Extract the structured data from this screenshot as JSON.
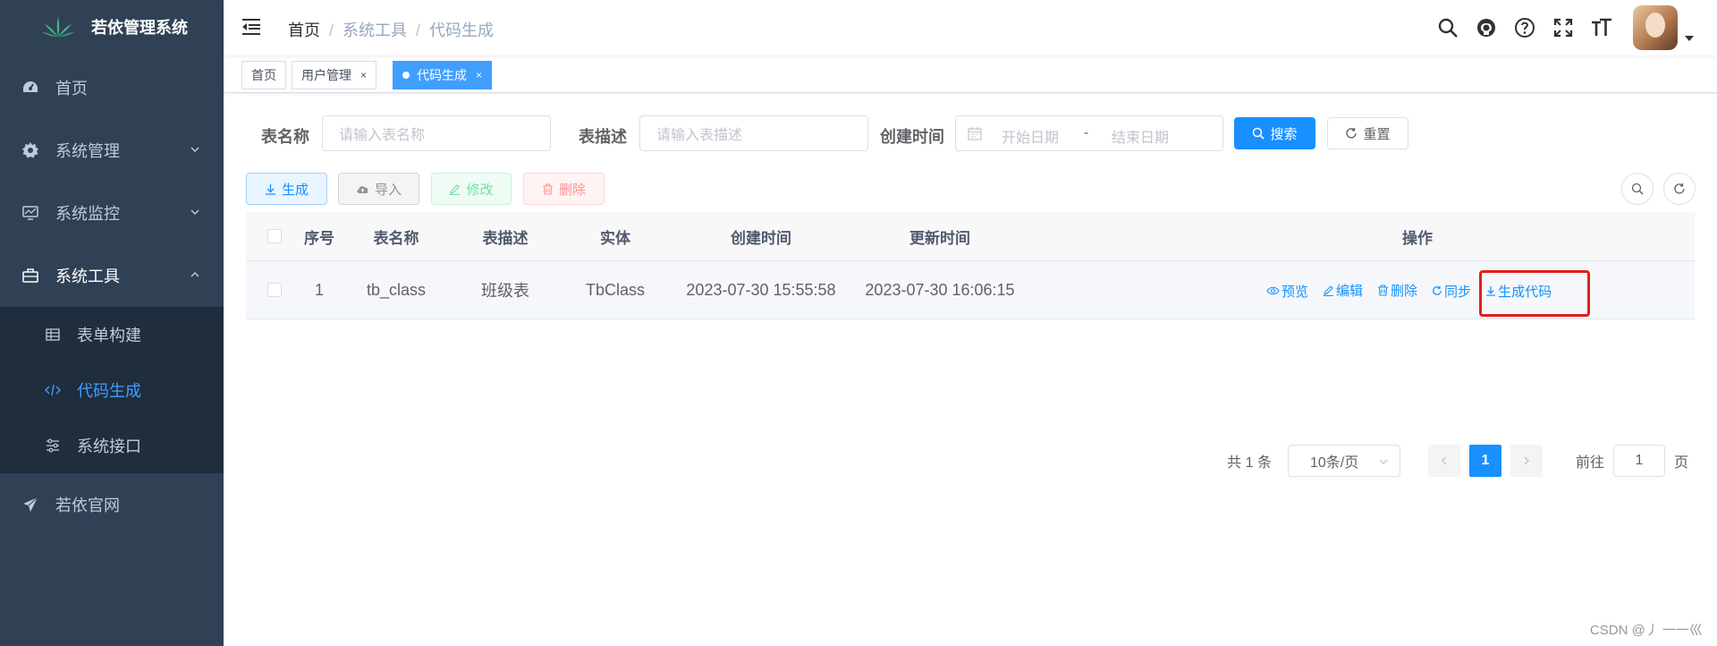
{
  "sidebar": {
    "logo_title": "若依管理系统",
    "items": [
      {
        "label": "首页",
        "icon": "dashboard-icon"
      },
      {
        "label": "系统管理",
        "icon": "gear-icon"
      },
      {
        "label": "系统监控",
        "icon": "monitor-icon"
      },
      {
        "label": "系统工具",
        "icon": "toolbox-icon"
      },
      {
        "label": "若依官网",
        "icon": "send-icon"
      }
    ],
    "submenu": [
      {
        "label": "表单构建",
        "icon": "table-icon"
      },
      {
        "label": "代码生成",
        "icon": "code-icon"
      },
      {
        "label": "系统接口",
        "icon": "sliders-icon"
      }
    ]
  },
  "navbar": {
    "breadcrumb": [
      "首页",
      "系统工具",
      "代码生成"
    ],
    "right_icons": [
      "search-icon",
      "github-icon",
      "question-icon",
      "fullscreen-icon",
      "font-size-icon"
    ]
  },
  "tags": [
    {
      "label": "首页"
    },
    {
      "label": "用户管理",
      "close": "×"
    },
    {
      "label": "代码生成",
      "close": "×",
      "active": true
    }
  ],
  "search_form": {
    "table_name_label": "表名称",
    "table_name_placeholder": "请输入表名称",
    "table_desc_label": "表描述",
    "table_desc_placeholder": "请输入表描述",
    "create_time_label": "创建时间",
    "start_date_placeholder": "开始日期",
    "range_separator": "-",
    "end_date_placeholder": "结束日期",
    "search_button": "搜索",
    "reset_button": "重置"
  },
  "toolbar": {
    "generate": "生成",
    "import": "导入",
    "edit": "修改",
    "delete": "删除"
  },
  "table": {
    "columns": [
      "序号",
      "表名称",
      "表描述",
      "实体",
      "创建时间",
      "更新时间",
      "操作"
    ],
    "rows": [
      {
        "index": "1",
        "table_name": "tb_class",
        "table_desc": "班级表",
        "entity": "TbClass",
        "create_time": "2023-07-30 15:55:58",
        "update_time": "2023-07-30 16:06:15",
        "actions": [
          "预览",
          "编辑",
          "删除",
          "同步",
          "生成代码"
        ]
      }
    ]
  },
  "pagination": {
    "total_text": "共 1 条",
    "page_size": "10条/页",
    "current_page": "1",
    "goto_prefix": "前往",
    "goto_value": "1",
    "goto_suffix": "页"
  },
  "watermark": "CSDN @丿 一一巛",
  "colors": {
    "sidebar_bg": "#304156",
    "submenu_bg": "#1f2d3d",
    "primary": "#1890ff",
    "highlight_box": "#e0201c"
  }
}
